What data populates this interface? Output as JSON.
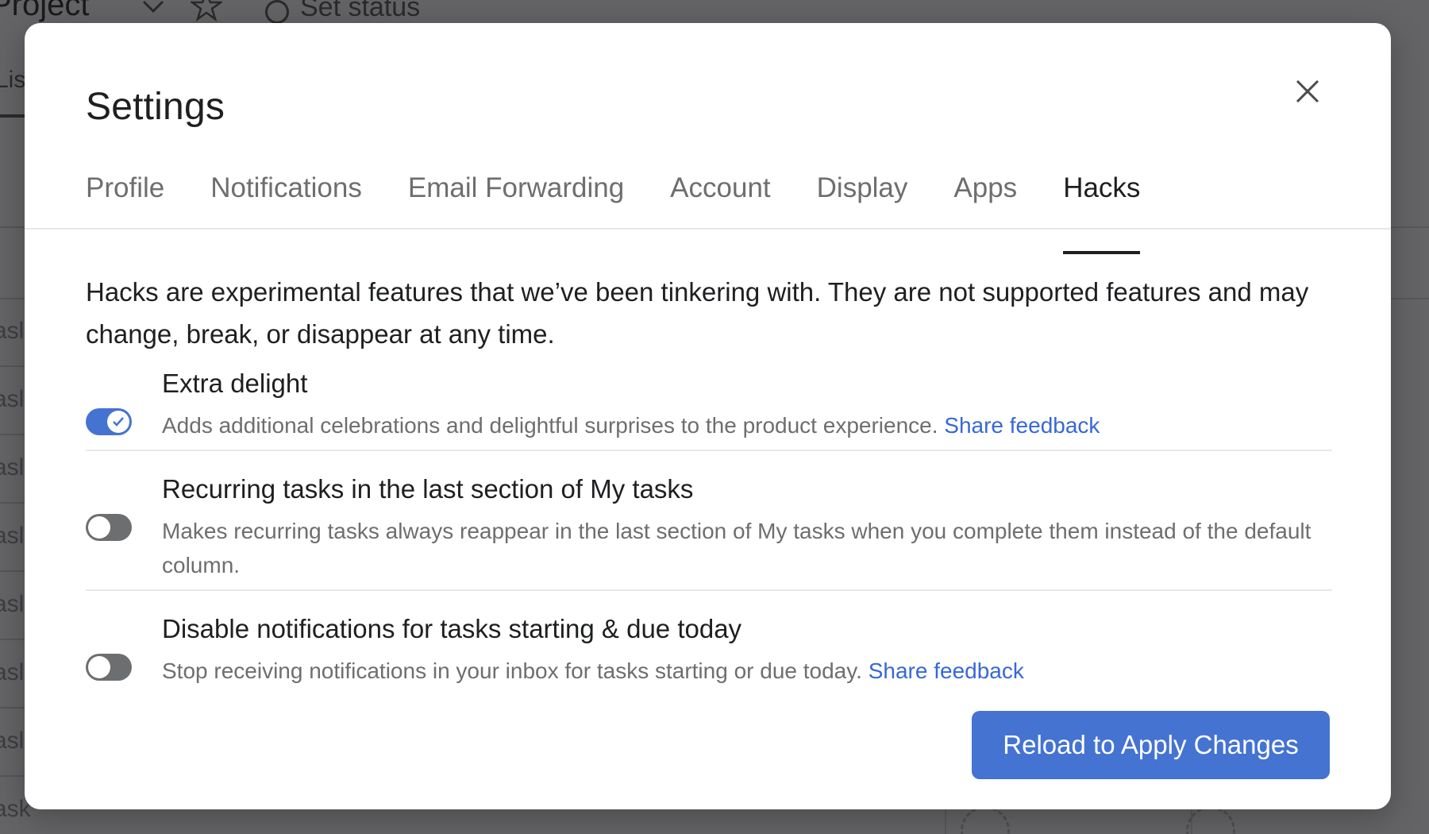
{
  "background": {
    "project_title": "Project",
    "set_status": "Set status",
    "list_tab": "Lis",
    "task_fragments": [
      "asl",
      "asl",
      "asl",
      "asl",
      "asl",
      "asl",
      "asl",
      "ask"
    ]
  },
  "modal": {
    "title": "Settings",
    "close_icon": "close-icon",
    "tabs": [
      {
        "label": "Profile",
        "active": false
      },
      {
        "label": "Notifications",
        "active": false
      },
      {
        "label": "Email Forwarding",
        "active": false
      },
      {
        "label": "Account",
        "active": false
      },
      {
        "label": "Display",
        "active": false
      },
      {
        "label": "Apps",
        "active": false
      },
      {
        "label": "Hacks",
        "active": true
      }
    ],
    "intro": "Hacks are experimental features that we’ve been tinkering with. They are not supported features and may change, break, or disappear at any time.",
    "hacks": [
      {
        "title": "Extra delight",
        "description": "Adds additional celebrations and delightful surprises to the product experience.",
        "link": "Share feedback",
        "enabled": true
      },
      {
        "title": "Recurring tasks in the last section of My tasks",
        "description": "Makes recurring tasks always reappear in the last section of My tasks when you complete them instead of the default column.",
        "link": "",
        "enabled": false
      },
      {
        "title": "Disable notifications for tasks starting & due today",
        "description": "Stop receiving notifications in your inbox for tasks starting or due today.",
        "link": "Share feedback",
        "enabled": false
      }
    ],
    "reload_button": "Reload to Apply Changes"
  },
  "colors": {
    "accent": "#4573d2",
    "link": "#3768d6",
    "toggle_off": "#6d6e6f",
    "overlay": "#646466"
  }
}
